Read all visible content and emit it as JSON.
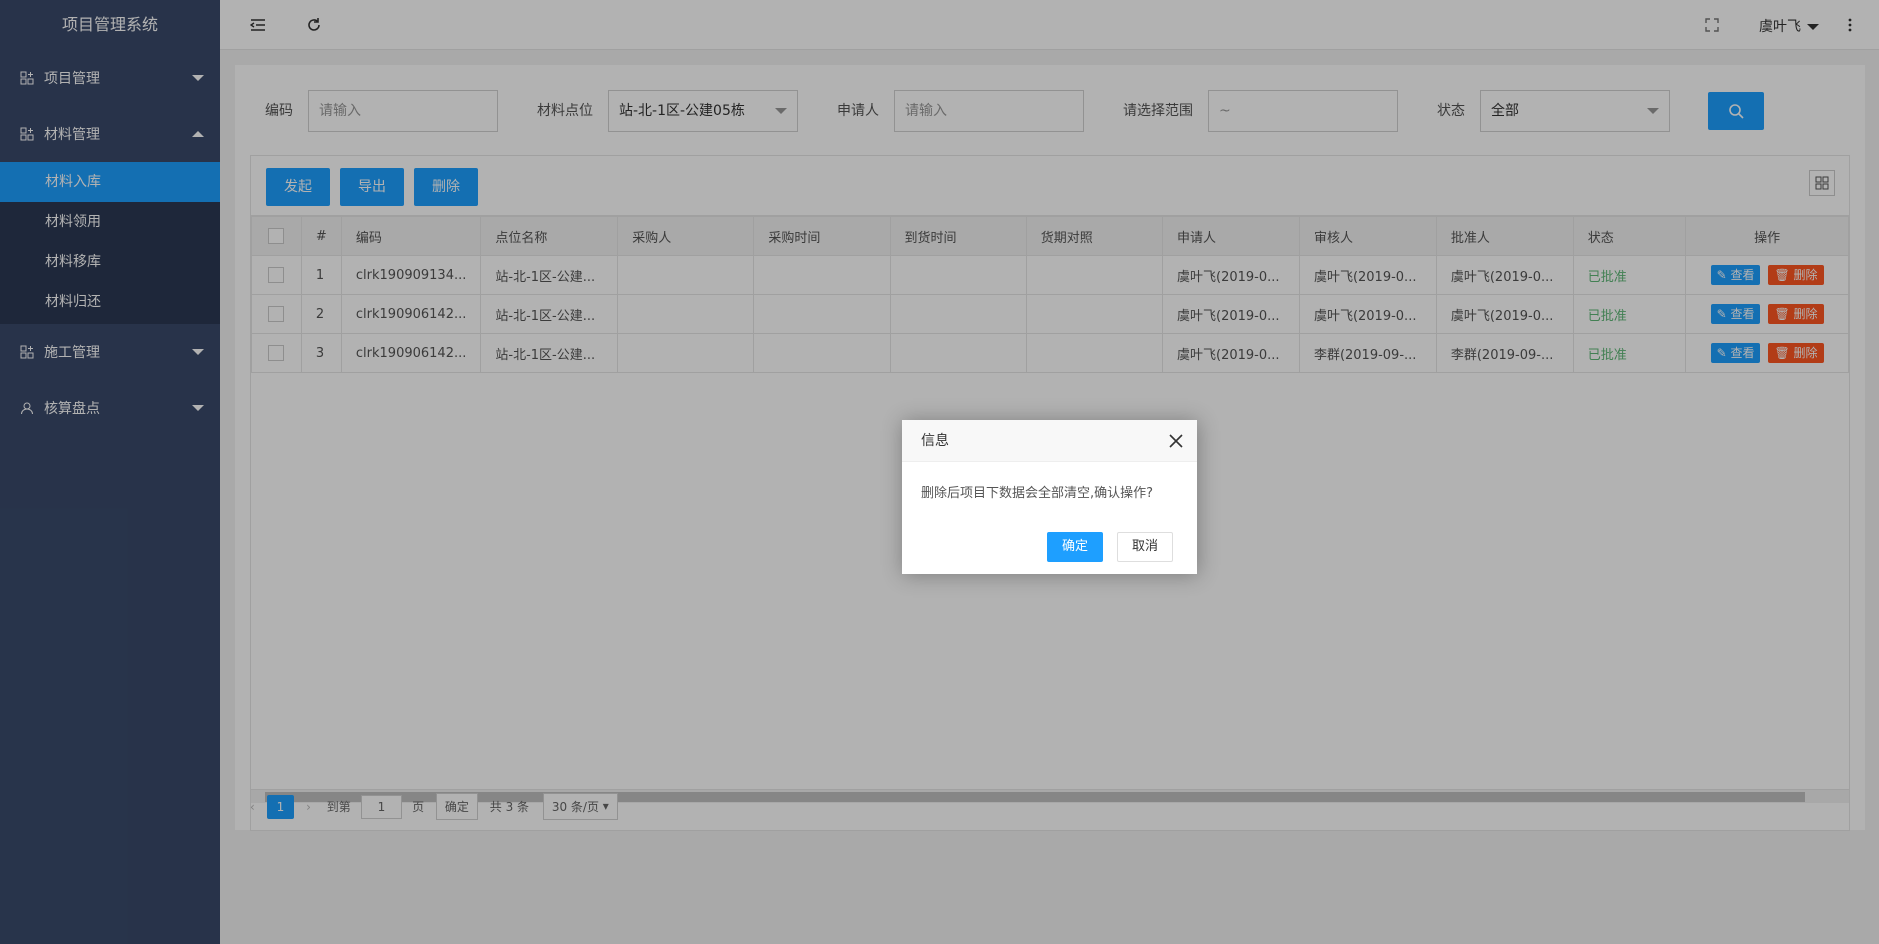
{
  "app": {
    "title": "项目管理系统"
  },
  "sidebar": {
    "items": [
      {
        "label": "项目管理",
        "expanded": false
      },
      {
        "label": "材料管理",
        "expanded": true,
        "children": [
          "材料入库",
          "材料领用",
          "材料移库",
          "材料归还"
        ],
        "active_child": "材料入库"
      },
      {
        "label": "施工管理",
        "expanded": false
      },
      {
        "label": "核算盘点",
        "expanded": false
      }
    ]
  },
  "topbar": {
    "user": "虞叶飞"
  },
  "filters": {
    "code_label": "编码",
    "code_placeholder": "请输入",
    "point_label": "材料点位",
    "point_value": "站-北-1区-公建05栋",
    "applicant_label": "申请人",
    "applicant_placeholder": "请输入",
    "range_label": "请选择范围",
    "range_placeholder": "~",
    "status_label": "状态",
    "status_value": "全部"
  },
  "toolbar": {
    "start": "发起",
    "export": "导出",
    "delete": "删除"
  },
  "table": {
    "headers": [
      "#",
      "编码",
      "点位名称",
      "采购人",
      "采购时间",
      "到货时间",
      "货期对照",
      "申请人",
      "审核人",
      "批准人",
      "状态",
      "操作"
    ],
    "rows": [
      {
        "no": "1",
        "code": "clrk190909134...",
        "point": "站-北-1区-公建...",
        "buyer": "",
        "buy_time": "",
        "arrive_time": "",
        "compare": "",
        "applicant": "虞叶飞(2019-0...",
        "reviewer": "虞叶飞(2019-0...",
        "approver": "虞叶飞(2019-0...",
        "status": "已批准"
      },
      {
        "no": "2",
        "code": "clrk190906142...",
        "point": "站-北-1区-公建...",
        "buyer": "",
        "buy_time": "",
        "arrive_time": "",
        "compare": "",
        "applicant": "虞叶飞(2019-0...",
        "reviewer": "虞叶飞(2019-0...",
        "approver": "虞叶飞(2019-0...",
        "status": "已批准"
      },
      {
        "no": "3",
        "code": "clrk190906142...",
        "point": "站-北-1区-公建...",
        "buyer": "",
        "buy_time": "",
        "arrive_time": "",
        "compare": "",
        "applicant": "虞叶飞(2019-0...",
        "reviewer": "李群(2019-09-...",
        "approver": "李群(2019-09-...",
        "status": "已批准"
      }
    ],
    "view_label": "查看",
    "delete_label": "删除"
  },
  "pager": {
    "current": "1",
    "goto_label": "到第",
    "goto_value": "1",
    "page_unit": "页",
    "confirm": "确定",
    "total": "共 3 条",
    "page_size": "30 条/页"
  },
  "dialog": {
    "title": "信息",
    "message": "删除后项目下数据会全部清空,确认操作?",
    "ok": "确定",
    "cancel": "取消"
  },
  "colors": {
    "primary": "#1e9fff",
    "danger": "#ff5722",
    "success": "#5fb878",
    "sidebar": "#3a4a6b"
  }
}
